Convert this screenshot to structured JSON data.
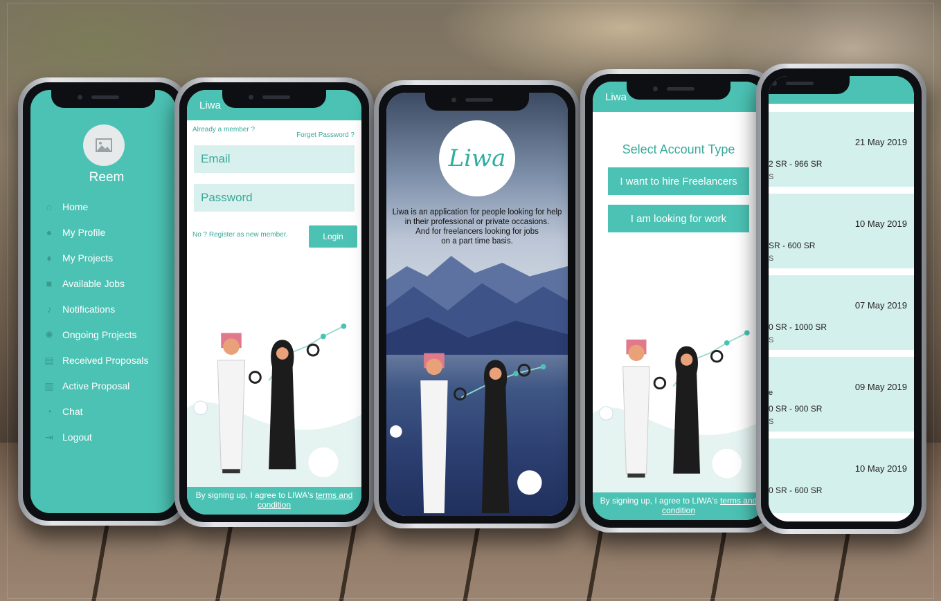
{
  "menu_phone": {
    "user_name": "Reem",
    "items": [
      {
        "label": "Home",
        "icon": "home-icon",
        "glyph": "⌂"
      },
      {
        "label": "My Profile",
        "icon": "user-icon",
        "glyph": "●"
      },
      {
        "label": "My Projects",
        "icon": "bulb-icon",
        "glyph": "♦"
      },
      {
        "label": "Available Jobs",
        "icon": "briefcase-icon",
        "glyph": "■"
      },
      {
        "label": "Notifications",
        "icon": "bell-icon",
        "glyph": "♪"
      },
      {
        "label": "Ongoing Projects",
        "icon": "idea-icon",
        "glyph": "✺"
      },
      {
        "label": "Received Proposals",
        "icon": "document-icon",
        "glyph": "▤"
      },
      {
        "label": "Active Proposal",
        "icon": "list-icon",
        "glyph": "▥"
      },
      {
        "label": "Chat",
        "icon": "chat-icon",
        "glyph": "◔"
      },
      {
        "label": "Logout",
        "icon": "logout-icon",
        "glyph": "⇥"
      }
    ]
  },
  "login_phone": {
    "app_title": "Liwa",
    "already_member": "Already a member ?",
    "forget_password": "Forget Password ?",
    "email_placeholder": "Email",
    "password_placeholder": "Password",
    "register_text": "No ? Register as new member.",
    "login_label": "Login",
    "footer_prefix": "By signing up, I agree to LIWA's",
    "footer_link": "terms and condition"
  },
  "splash_phone": {
    "logo_text": "Liwa",
    "tagline_lines": [
      "Liwa is an application for people looking for help",
      "in their professional or private occasions.",
      "And for freelancers looking for jobs",
      "on a part time basis."
    ]
  },
  "account_phone": {
    "app_title": "Liwa",
    "title": "Select Account Type",
    "hire_label": "I want to hire Freelancers",
    "work_label": "I am looking for work",
    "footer_prefix": "By signing up, I agree to LIWA's",
    "footer_link": "terms and condition"
  },
  "projects_phone": {
    "cards": [
      {
        "date": "21 May 2019",
        "price": "2 SR - 966 SR",
        "sub": "S",
        "mark": ""
      },
      {
        "date": "10 May 2019",
        "price": "SR - 600 SR",
        "sub": "S",
        "mark": ""
      },
      {
        "date": "07 May 2019",
        "price": "0 SR - 1000 SR",
        "sub": "S",
        "mark": ""
      },
      {
        "date": "09 May 2019",
        "price": "0 SR - 900 SR",
        "sub": "S",
        "mark": "e"
      },
      {
        "date": "10 May 2019",
        "price": "0 SR - 600 SR",
        "sub": "",
        "mark": ""
      }
    ]
  },
  "colors": {
    "accent": "#4cc2b4",
    "accent_light": "#d9f1ee",
    "text_dark": "#222222"
  }
}
